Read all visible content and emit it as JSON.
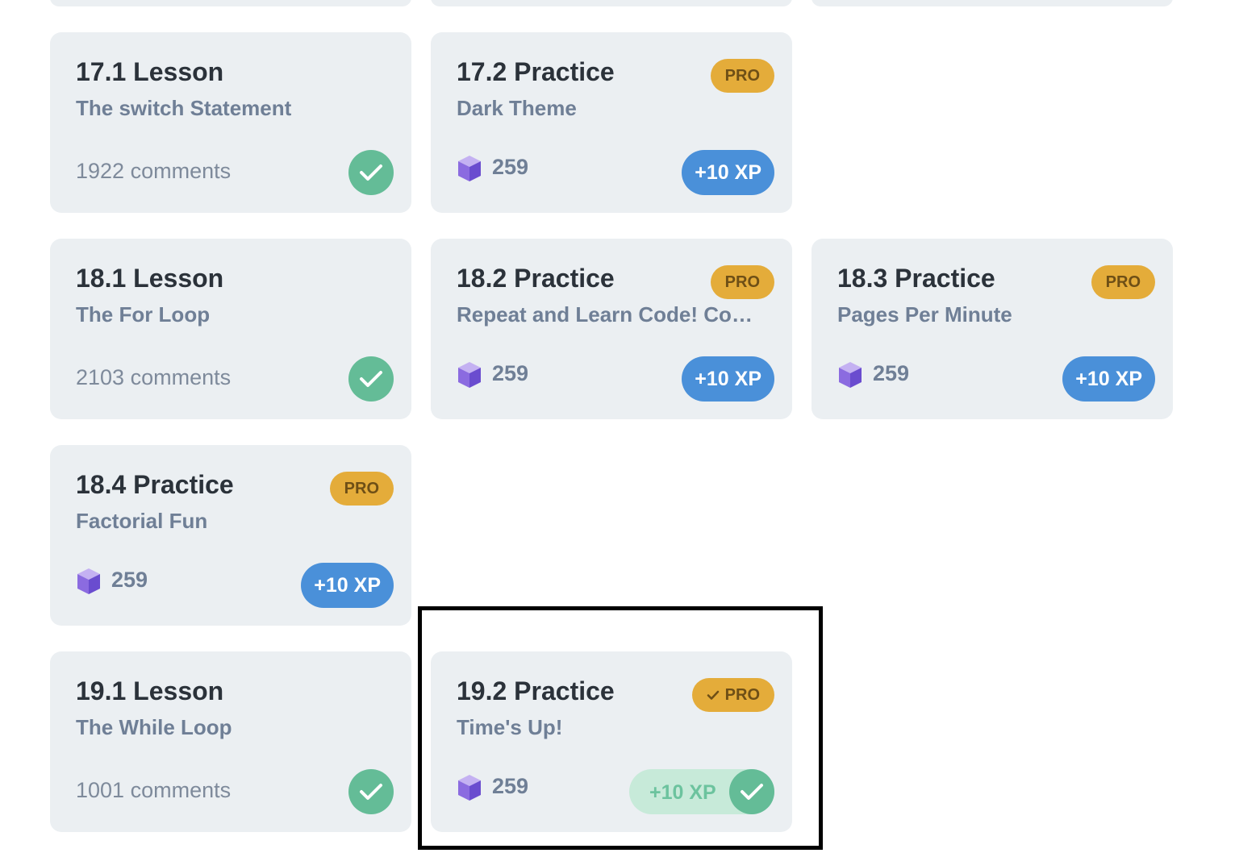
{
  "colors": {
    "card_bg": "#ebeff2",
    "complete_green": "#64bc97",
    "pro_badge": "#e4ac3a",
    "xp_blue": "#4a90d9",
    "gem_purple": "#8b6be0"
  },
  "cards": {
    "c171": {
      "title": "17.1 Lesson",
      "subtitle": "The switch Statement",
      "comments": "1922 comments",
      "icon": "check-circle-icon"
    },
    "c172": {
      "title": "17.2 Practice",
      "subtitle": "Dark Theme",
      "pro": "PRO",
      "gems": "259",
      "xp": "+10 XP",
      "icon": "gem-icon"
    },
    "c181": {
      "title": "18.1 Lesson",
      "subtitle": "The For Loop",
      "comments": "2103 comments",
      "icon": "check-circle-icon"
    },
    "c182": {
      "title": "18.2 Practice",
      "subtitle": "Repeat and Learn Code! Code!...",
      "pro": "PRO",
      "gems": "259",
      "xp": "+10 XP"
    },
    "c183": {
      "title": "18.3 Practice",
      "subtitle": "Pages Per Minute",
      "pro": "PRO",
      "gems": "259",
      "xp": "+10 XP"
    },
    "c184": {
      "title": "18.4 Practice",
      "subtitle": "Factorial Fun",
      "pro": "PRO",
      "gems": "259",
      "xp": "+10 XP"
    },
    "c191": {
      "title": "19.1 Lesson",
      "subtitle": "The While Loop",
      "comments": "1001 comments",
      "icon": "check-circle-icon"
    },
    "c192": {
      "title": "19.2 Practice",
      "subtitle": "Time's Up!",
      "pro": "PRO",
      "pro_icon": "checkmark-icon",
      "gems": "259",
      "xp": "+10 XP",
      "completed": true
    }
  }
}
